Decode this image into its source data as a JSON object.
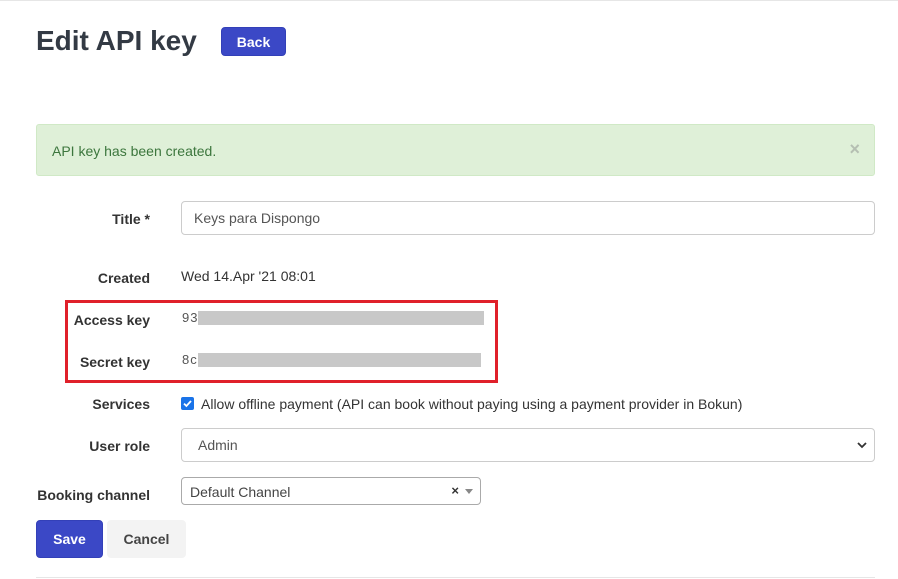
{
  "header": {
    "title": "Edit API key",
    "back_label": "Back"
  },
  "alert": {
    "message": "API key has been created.",
    "close_glyph": "×"
  },
  "form": {
    "title": {
      "label": "Title *",
      "value": "Keys para Dispongo"
    },
    "created": {
      "label": "Created",
      "value": "Wed 14.Apr '21 08:01"
    },
    "access_key": {
      "label": "Access key",
      "visible_prefix": "93"
    },
    "secret_key": {
      "label": "Secret key",
      "visible_prefix": "8c"
    },
    "services": {
      "label": "Services",
      "checkbox_label": "Allow offline payment (API can book without paying using a payment provider in Bokun)",
      "checked": true
    },
    "user_role": {
      "label": "User role",
      "selected": "Admin"
    },
    "booking_channel": {
      "label": "Booking channel",
      "selected": "Default Channel",
      "clear_glyph": "×"
    }
  },
  "actions": {
    "save_label": "Save",
    "cancel_label": "Cancel"
  },
  "colors": {
    "primary": "#3b48c6",
    "alert_bg": "#dff0d8",
    "alert_text": "#3c763d",
    "highlight": "#e0202a",
    "checkbox": "#1a73e8"
  }
}
